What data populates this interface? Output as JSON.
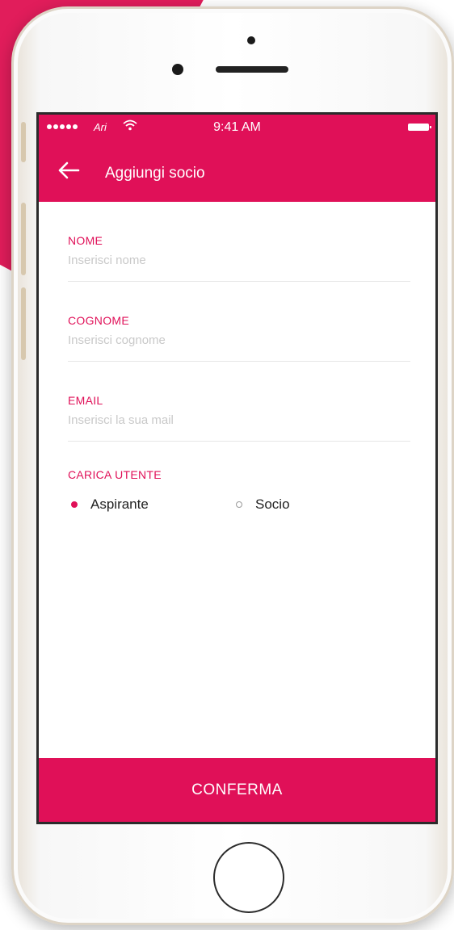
{
  "colors": {
    "accent": "#e01058",
    "background_accent": "#e11d5b",
    "text": "#222222",
    "placeholder": "#c9c9c9"
  },
  "status_bar": {
    "carrier": "Ari",
    "time": "9:41 AM",
    "wifi_icon": "wifi-icon",
    "battery_icon": "battery-icon"
  },
  "header": {
    "back_icon": "arrow-left-icon",
    "title": "Aggiungi socio"
  },
  "form": {
    "fields": [
      {
        "label": "NOME",
        "placeholder": "Inserisci nome",
        "value": ""
      },
      {
        "label": "COGNOME",
        "placeholder": "Inserisci cognome",
        "value": ""
      },
      {
        "label": "EMAIL",
        "placeholder": "Inserisci la sua mail",
        "value": ""
      }
    ],
    "role": {
      "label": "CARICA UTENTE",
      "options": [
        {
          "label": "Aspirante",
          "selected": true
        },
        {
          "label": "Socio",
          "selected": false
        }
      ]
    }
  },
  "footer": {
    "confirm_label": "CONFERMA"
  }
}
